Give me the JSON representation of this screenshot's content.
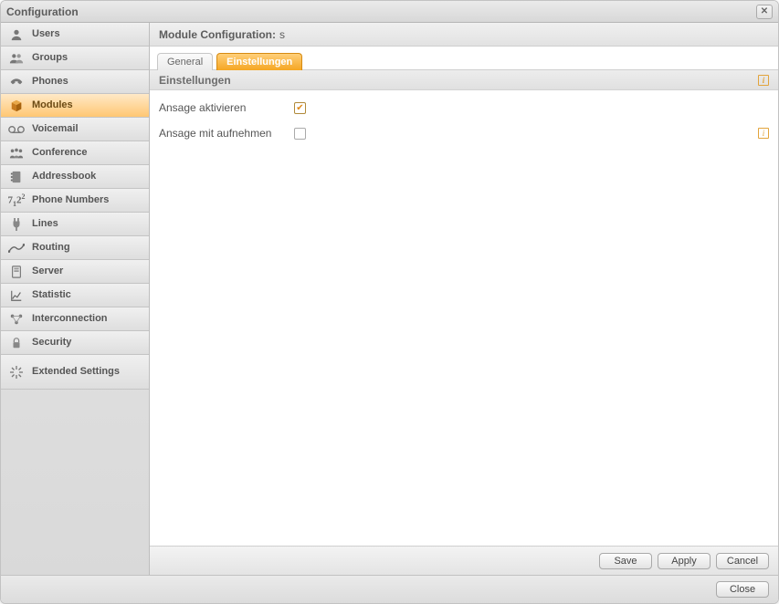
{
  "window": {
    "title": "Configuration"
  },
  "sidebar": {
    "items": [
      {
        "icon": "user-icon",
        "label": "Users"
      },
      {
        "icon": "users-icon",
        "label": "Groups"
      },
      {
        "icon": "phone-icon",
        "label": "Phones"
      },
      {
        "icon": "cube-icon",
        "label": "Modules",
        "active": true
      },
      {
        "icon": "voicemail-icon",
        "label": "Voicemail"
      },
      {
        "icon": "conference-icon",
        "label": "Conference"
      },
      {
        "icon": "addressbook-icon",
        "label": "Addressbook"
      },
      {
        "icon": "numbers-icon",
        "label": "Phone Numbers"
      },
      {
        "icon": "plug-icon",
        "label": "Lines"
      },
      {
        "icon": "routing-icon",
        "label": "Routing"
      },
      {
        "icon": "server-icon",
        "label": "Server"
      },
      {
        "icon": "statistic-icon",
        "label": "Statistic"
      },
      {
        "icon": "interconnection-icon",
        "label": "Interconnection"
      },
      {
        "icon": "security-icon",
        "label": "Security"
      },
      {
        "icon": "extended-icon",
        "label": "Extended Settings"
      }
    ]
  },
  "header": {
    "label": "Module Configuration:",
    "value": "s"
  },
  "tabs": [
    {
      "label": "General",
      "active": false
    },
    {
      "label": "Einstellungen",
      "active": true
    }
  ],
  "section": {
    "title": "Einstellungen",
    "fields": [
      {
        "label": "Ansage aktivieren",
        "checked": true,
        "has_info": false
      },
      {
        "label": "Ansage mit aufnehmen",
        "checked": false,
        "has_info": true
      }
    ]
  },
  "buttons": {
    "save": "Save",
    "apply": "Apply",
    "cancel": "Cancel",
    "close": "Close"
  }
}
